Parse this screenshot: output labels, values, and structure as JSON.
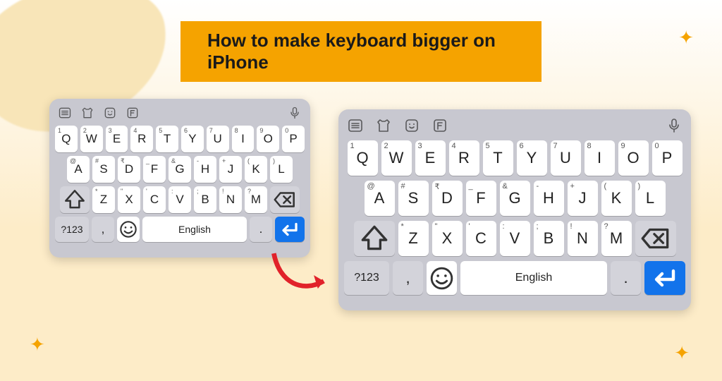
{
  "title": "How to make keyboard bigger on iPhone",
  "toolbar_icons": [
    "menu-icon",
    "shirt-icon",
    "sticker-icon",
    "font-icon",
    "mic-icon"
  ],
  "rows": {
    "r1": [
      {
        "l": "Q",
        "s": "1"
      },
      {
        "l": "W",
        "s": "2"
      },
      {
        "l": "E",
        "s": "3"
      },
      {
        "l": "R",
        "s": "4"
      },
      {
        "l": "T",
        "s": "5"
      },
      {
        "l": "Y",
        "s": "6"
      },
      {
        "l": "U",
        "s": "7"
      },
      {
        "l": "I",
        "s": "8"
      },
      {
        "l": "O",
        "s": "9"
      },
      {
        "l": "P",
        "s": "0"
      }
    ],
    "r2": [
      {
        "l": "A",
        "s": "@"
      },
      {
        "l": "S",
        "s": "#"
      },
      {
        "l": "D",
        "s": "₹"
      },
      {
        "l": "F",
        "s": "_"
      },
      {
        "l": "G",
        "s": "&"
      },
      {
        "l": "H",
        "s": "-"
      },
      {
        "l": "J",
        "s": "+"
      },
      {
        "l": "K",
        "s": "("
      },
      {
        "l": "L",
        "s": ")"
      }
    ],
    "r3": [
      {
        "l": "Z",
        "s": "*"
      },
      {
        "l": "X",
        "s": "\""
      },
      {
        "l": "C",
        "s": "'"
      },
      {
        "l": "V",
        "s": ":"
      },
      {
        "l": "B",
        "s": ";"
      },
      {
        "l": "N",
        "s": "!"
      },
      {
        "l": "M",
        "s": "?"
      }
    ]
  },
  "numKey": "?123",
  "commaKey": ",",
  "dotKey": ".",
  "spaceLabel": "English"
}
